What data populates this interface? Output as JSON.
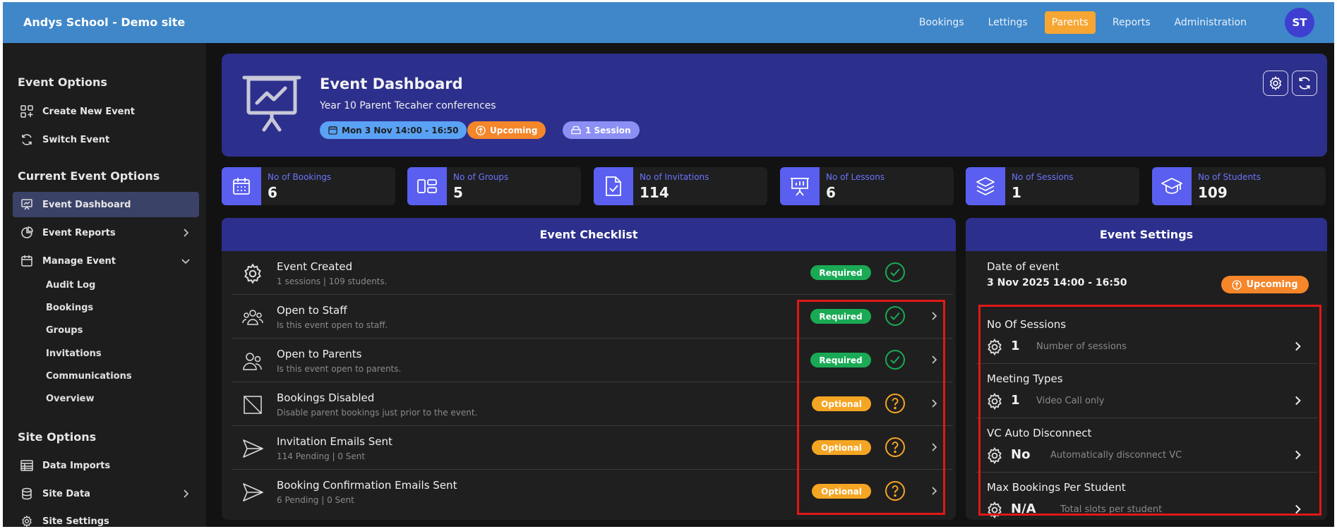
{
  "app": {
    "title": "Andys School - Demo site"
  },
  "topnav": {
    "items": [
      "Bookings",
      "Lettings",
      "Parents",
      "Reports",
      "Administration"
    ],
    "active": "Parents",
    "avatar_initials": "ST"
  },
  "sidebar": {
    "event_options_title": "Event Options",
    "create_new_event": "Create New Event",
    "switch_event": "Switch Event",
    "current_event_title": "Current Event Options",
    "event_dashboard": "Event Dashboard",
    "event_reports": "Event Reports",
    "manage_event": "Manage Event",
    "manage_sub": [
      "Audit Log",
      "Bookings",
      "Groups",
      "Invitations",
      "Communications",
      "Overview"
    ],
    "site_options_title": "Site Options",
    "data_imports": "Data Imports",
    "site_data": "Site Data",
    "site_settings": "Site Settings"
  },
  "hero": {
    "title": "Event Dashboard",
    "subtitle": "Year 10 Parent Tecaher conferences",
    "date_pill": "Mon 3 Nov 14:00 - 16:50",
    "status_pill": "Upcoming",
    "session_pill": "1 Session"
  },
  "stats": [
    {
      "label": "No of Bookings",
      "value": "6",
      "icon": "calendar-icon"
    },
    {
      "label": "No of Groups",
      "value": "5",
      "icon": "groups-icon"
    },
    {
      "label": "No of Invitations",
      "value": "114",
      "icon": "invitation-icon"
    },
    {
      "label": "No of Lessons",
      "value": "6",
      "icon": "presentation-icon"
    },
    {
      "label": "No of Sessions",
      "value": "1",
      "icon": "layers-icon"
    },
    {
      "label": "No of Students",
      "value": "109",
      "icon": "graduation-cap-icon"
    }
  ],
  "checklist": {
    "title": "Event Checklist",
    "rows": [
      {
        "title": "Event Created",
        "sub": "1 sessions | 109 students.",
        "badge": "Required",
        "state": "done"
      },
      {
        "title": "Open to Staff",
        "sub": "Is this event open to staff.",
        "badge": "Required",
        "state": "done"
      },
      {
        "title": "Open to Parents",
        "sub": "Is this event open to parents.",
        "badge": "Required",
        "state": "done"
      },
      {
        "title": "Bookings Disabled",
        "sub": "Disable parent bookings just prior to the event.",
        "badge": "Optional",
        "state": "unknown"
      },
      {
        "title": "Invitation Emails Sent",
        "sub": "114 Pending | 0 Sent",
        "badge": "Optional",
        "state": "unknown"
      },
      {
        "title": "Booking Confirmation Emails Sent",
        "sub": "6 Pending | 0 Sent",
        "badge": "Optional",
        "state": "unknown"
      }
    ]
  },
  "settings": {
    "title": "Event Settings",
    "date_label": "Date of event",
    "date_value": "3 Nov 2025 14:00 - 16:50",
    "status": "Upcoming",
    "rows": [
      {
        "title": "No Of Sessions",
        "value": "1",
        "desc": "Number of sessions"
      },
      {
        "title": "Meeting Types",
        "value": "1",
        "desc": "Video Call only"
      },
      {
        "title": "VC Auto Disconnect",
        "value": "No",
        "desc": "Automatically disconnect VC"
      },
      {
        "title": "Max Bookings Per Student",
        "value": "N/A",
        "desc": "Total slots per student"
      }
    ]
  },
  "colors": {
    "accent": "#5a5ff0",
    "header": "#3f87c9",
    "panel_head": "#2d2f8d",
    "required": "#1aaa55",
    "optional": "#f5a524",
    "highlight": "#e01818"
  }
}
